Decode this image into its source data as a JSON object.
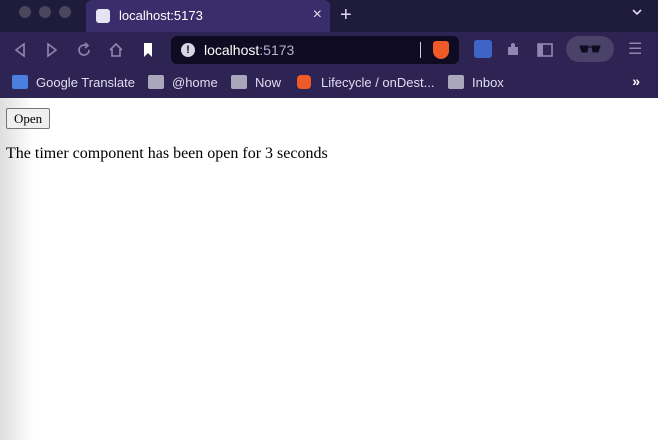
{
  "browser": {
    "tab": {
      "title": "localhost:5173",
      "icon": "svelte-icon"
    },
    "address": {
      "host": "localhost",
      "port": ":5173"
    },
    "bookmarks": [
      {
        "label": "Google Translate",
        "icon": "google-translate-icon"
      },
      {
        "label": "@home",
        "icon": "folder-icon"
      },
      {
        "label": "Now",
        "icon": "folder-icon"
      },
      {
        "label": "Lifecycle / onDest...",
        "icon": "svelte-icon"
      },
      {
        "label": "Inbox",
        "icon": "folder-icon"
      }
    ],
    "bookmarks_overflow": "»",
    "colors": {
      "tabstrip": "#1f1b3a",
      "active_tab": "#3a2d6b",
      "toolbar": "#2e2454",
      "urlbar": "#0f0b22",
      "brave": "#f05a28"
    }
  },
  "page": {
    "open_button_label": "Open",
    "timer_text": "The timer component has been open for 3 seconds"
  }
}
